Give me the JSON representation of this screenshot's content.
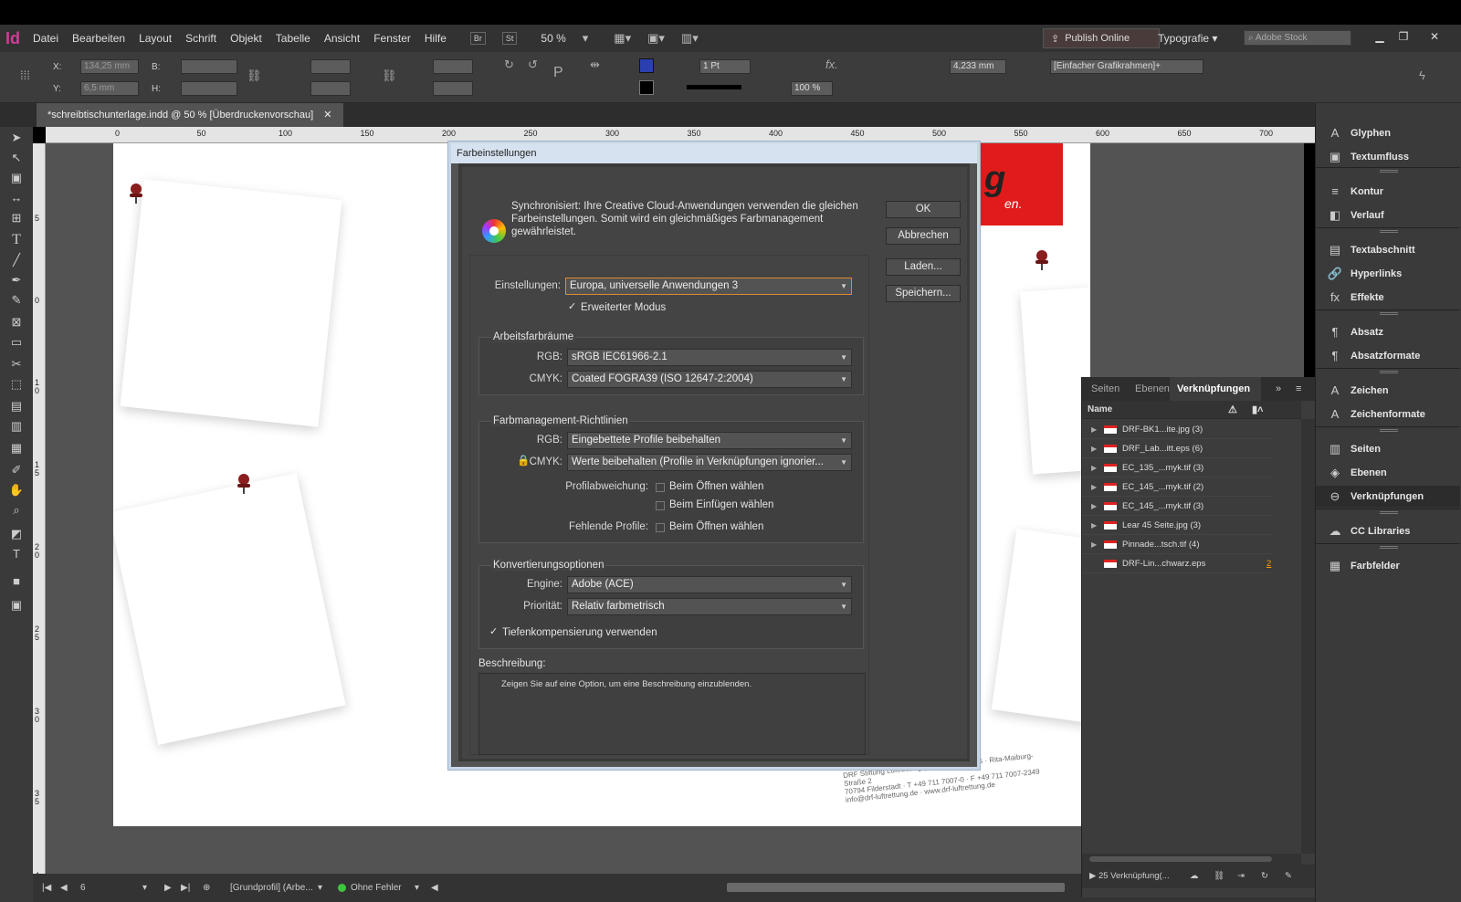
{
  "app": {
    "logo": "Id",
    "menu": [
      "Datei",
      "Bearbeiten",
      "Layout",
      "Schrift",
      "Objekt",
      "Tabelle",
      "Ansicht",
      "Fenster",
      "Hilfe"
    ],
    "mini_buttons": [
      "Br",
      "St"
    ],
    "zoom": "50 %",
    "publish_label": "Publish Online",
    "workspace": "Typografie",
    "stock_placeholder": "Adobe Stock"
  },
  "control_bar": {
    "x_label": "X:",
    "x_value": "134,25 mm",
    "y_label": "Y:",
    "y_value": "6,5 mm",
    "w_label": "B:",
    "h_label": "H:",
    "stroke_weight": "1 Pt",
    "opacity": "100 %",
    "offset_value": "4,233 mm",
    "object_style": "[Einfacher Grafikrahmen]+"
  },
  "document": {
    "tab_title": "*schreibtischunterlage.indd @ 50 % [Überdruckenvorschau]",
    "ruler_h": [
      "0",
      "50",
      "100",
      "150",
      "200",
      "250",
      "300",
      "350",
      "400",
      "450",
      "500",
      "550",
      "600",
      "650",
      "700"
    ],
    "ruler_v": [
      "5",
      "0",
      "1 0",
      "1 5",
      "2 0",
      "2 5",
      "3 0",
      "3 5",
      "4 0"
    ],
    "banner_text": "g",
    "banner_sub": "en.",
    "address_lines": [
      "DRF Stiftung Luftrettung gemeinnützige AG  ·  Rita-Maiburg-Straße 2",
      "70794 Filderstadt  ·  T +49 711 7007-0  ·  F +49 711 7007-2349",
      "info@drf-luftrettung.de  ·  www.drf-luftrettung.de"
    ]
  },
  "status_bar": {
    "page": "6",
    "profile": "[Grundprofil] (Arbe...",
    "preflight": "Ohne Fehler",
    "preflight_color": "#3ec43e"
  },
  "dialog": {
    "title": "Farbeinstellungen",
    "sync_text": "Synchronisiert: Ihre Creative Cloud-Anwendungen verwenden die gleichen Farbeinstellungen. Somit wird ein gleichmäßiges Farbmanagement gewährleistet.",
    "buttons": {
      "ok": "OK",
      "cancel": "Abbrechen",
      "load": "Laden...",
      "save": "Speichern..."
    },
    "settings_label": "Einstellungen:",
    "settings_value": "Europa, universelle Anwendungen 3",
    "advanced_mode": "Erweiterter Modus",
    "working_spaces": {
      "title": "Arbeitsfarbräume",
      "rgb_label": "RGB:",
      "rgb_value": "sRGB IEC61966-2.1",
      "cmyk_label": "CMYK:",
      "cmyk_value": "Coated FOGRA39 (ISO 12647-2:2004)"
    },
    "policies": {
      "title": "Farbmanagement-Richtlinien",
      "rgb_label": "RGB:",
      "rgb_value": "Eingebettete Profile beibehalten",
      "cmyk_label": "CMYK:",
      "cmyk_value": "Werte beibehalten (Profile in Verknüpfungen ignorier...",
      "mismatch_label": "Profilabweichung:",
      "mismatch_open": "Beim Öffnen wählen",
      "mismatch_paste": "Beim Einfügen wählen",
      "missing_label": "Fehlende Profile:",
      "missing_open": "Beim Öffnen wählen"
    },
    "conversion": {
      "title": "Konvertierungsoptionen",
      "engine_label": "Engine:",
      "engine_value": "Adobe (ACE)",
      "intent_label": "Priorität:",
      "intent_value": "Relativ farbmetrisch",
      "bpc": "Tiefenkompensierung verwenden"
    },
    "description_label": "Beschreibung:",
    "description_text": "Zeigen Sie auf eine Option, um eine Beschreibung einzublenden."
  },
  "links_panel": {
    "tabs": [
      "Seiten",
      "Ebenen",
      "Verknüpfungen"
    ],
    "header_name": "Name",
    "rows": [
      {
        "name": "DRF-BK1...ite.jpg (3)",
        "expandable": true
      },
      {
        "name": "DRF_Lab...itt.eps (6)",
        "expandable": true
      },
      {
        "name": "EC_135_...myk.tif (3)",
        "expandable": true
      },
      {
        "name": "EC_145_...myk.tif (2)",
        "expandable": true
      },
      {
        "name": "EC_145_...myk.tif (3)",
        "expandable": true
      },
      {
        "name": "Lear 45 Seite.jpg (3)",
        "expandable": true
      },
      {
        "name": "Pinnade...tsch.tif (4)",
        "expandable": true
      },
      {
        "name": "DRF-Lin...chwarz.eps",
        "expandable": false,
        "page": "2"
      }
    ],
    "footer": "25 Verknüpfung(..."
  },
  "right_panel": [
    {
      "icon": "glyphs-icon",
      "glyph": "A",
      "label": "Glyphen"
    },
    {
      "icon": "text-wrap-icon",
      "glyph": "▣",
      "label": "Textumfluss"
    },
    {
      "icon": "stroke-icon",
      "glyph": "≡",
      "label": "Kontur"
    },
    {
      "icon": "gradient-icon",
      "glyph": "◧",
      "label": "Verlauf"
    },
    {
      "icon": "text-frame-icon",
      "glyph": "▤",
      "label": "Textabschnitt"
    },
    {
      "icon": "hyperlinks-icon",
      "glyph": "🔗",
      "label": "Hyperlinks"
    },
    {
      "icon": "effects-icon",
      "glyph": "fx",
      "label": "Effekte"
    },
    {
      "icon": "paragraph-icon",
      "glyph": "¶",
      "label": "Absatz"
    },
    {
      "icon": "paragraph-styles-icon",
      "glyph": "¶",
      "label": "Absatzformate"
    },
    {
      "icon": "character-icon",
      "glyph": "A",
      "label": "Zeichen"
    },
    {
      "icon": "character-styles-icon",
      "glyph": "A",
      "label": "Zeichenformate"
    },
    {
      "icon": "pages-icon",
      "glyph": "▥",
      "label": "Seiten"
    },
    {
      "icon": "layers-icon",
      "glyph": "◈",
      "label": "Ebenen"
    },
    {
      "icon": "links-icon",
      "glyph": "⊖",
      "label": "Verknüpfungen"
    },
    {
      "icon": "cc-libraries-icon",
      "glyph": "☁",
      "label": "CC Libraries"
    },
    {
      "icon": "swatches-icon",
      "glyph": "▦",
      "label": "Farbfelder"
    }
  ]
}
